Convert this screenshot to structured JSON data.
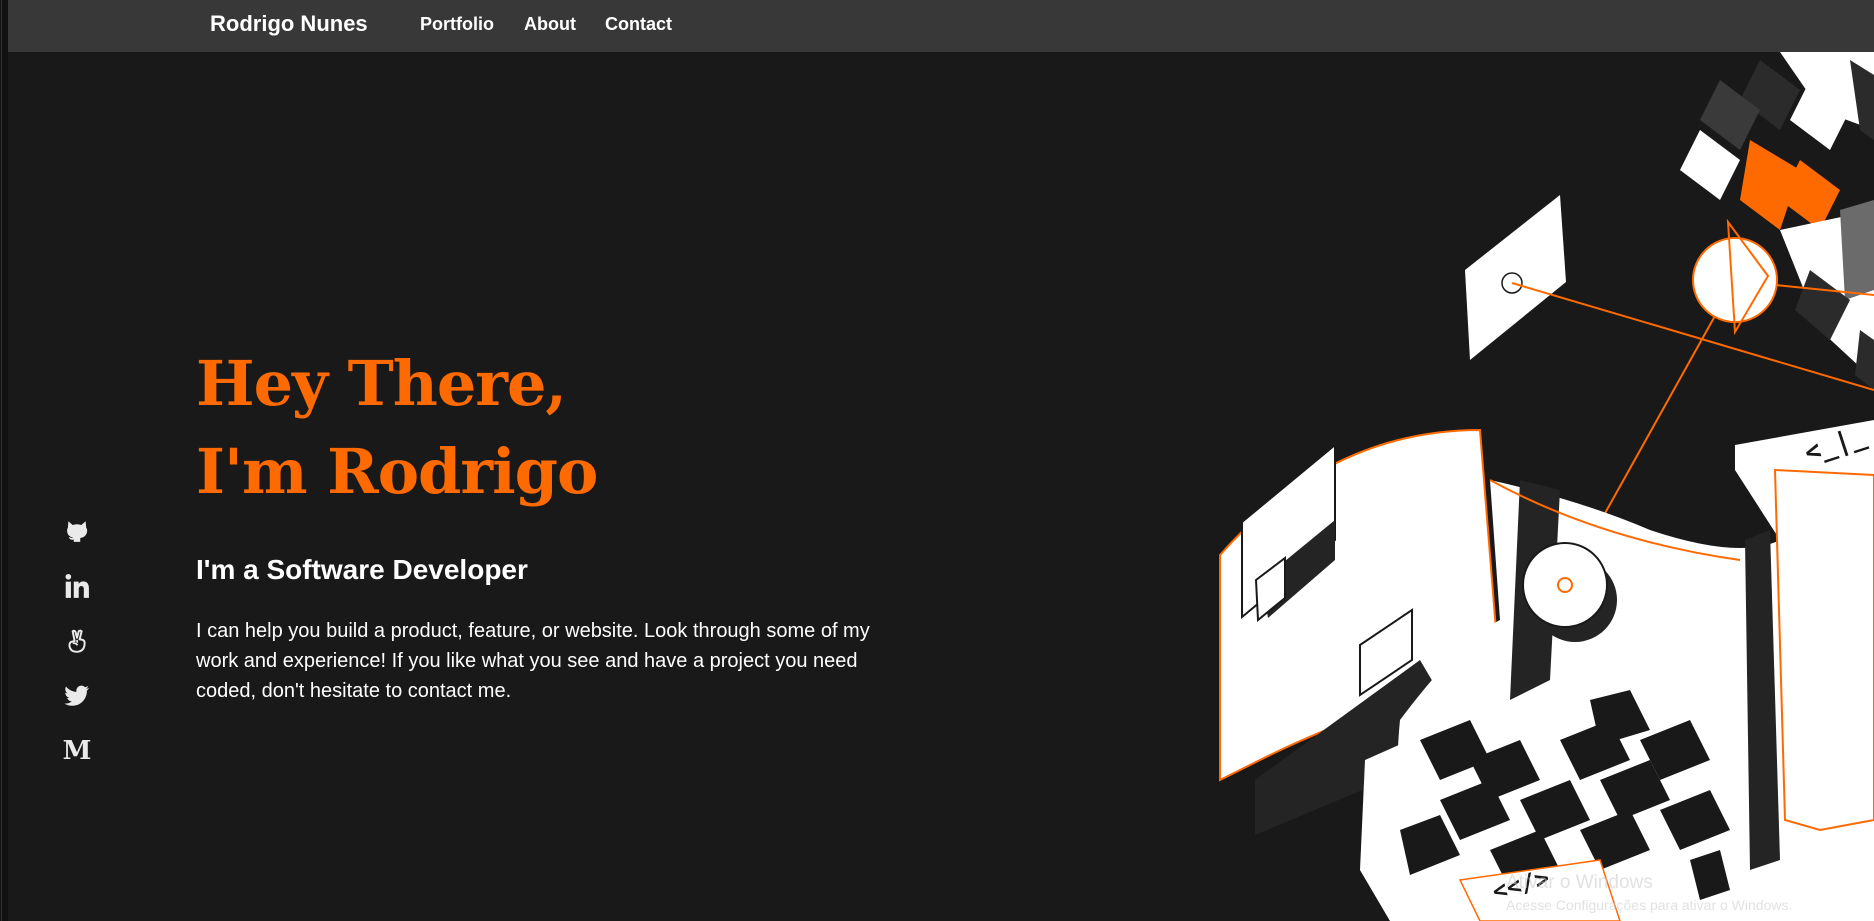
{
  "navbar": {
    "brand": "Rodrigo Nunes",
    "links": [
      "Portfolio",
      "About",
      "Contact"
    ]
  },
  "hero": {
    "title_line1": "Hey There,",
    "title_line2": "I'm Rodrigo",
    "subtitle": "I'm a Software Developer",
    "description": "I can help you build a product, feature, or website. Look through some of my work and experience! If you like what you see and have a project you need coded, don't hesitate to contact me."
  },
  "social": {
    "icons": [
      "github-icon",
      "linkedin-icon",
      "angellist-icon",
      "twitter-icon",
      "medium-icon"
    ],
    "medium_glyph": "M"
  },
  "illustration": {
    "code_tag_top": "<_|_",
    "code_tag_bottom": "<</>"
  },
  "watermark": {
    "title": "Ativar o Windows",
    "subtitle": "Acesse Configurações para ativar o Windows."
  },
  "colors": {
    "accent": "#ff6a00",
    "background": "#1a1919",
    "navbar": "#393838",
    "text": "#ffffff"
  }
}
